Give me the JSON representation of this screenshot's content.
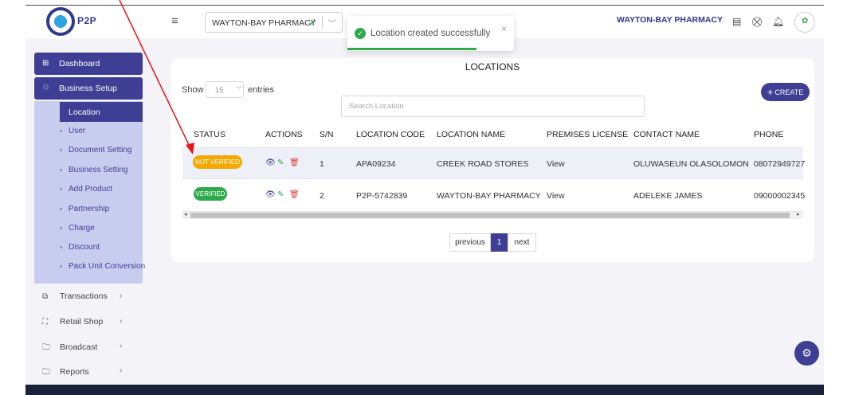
{
  "header": {
    "logo_text": "P2P",
    "branch_value": "WAYTON-BAY PHARMACY",
    "pharmacy_name": "WAYTON-BAY PHARMACY"
  },
  "toast": {
    "message": "Location created successfully",
    "close": "×"
  },
  "sidebar": {
    "dashboard": "Dashboard",
    "business_setup": "Business Setup",
    "sub_items": [
      "Location",
      "User",
      "Document Setting",
      "Business Setting",
      "Add Product",
      "Partnership",
      "Charge",
      "Discount",
      "Pack Unit Conversion"
    ],
    "items": [
      "Transactions",
      "Retail Shop",
      "Broadcast",
      "Reports"
    ]
  },
  "page": {
    "title": "LOCATIONS",
    "show_label": "Show",
    "entries_value": "15",
    "entries_label": "entries",
    "search_placeholder": "Search Location",
    "create_label": "CREATE"
  },
  "table": {
    "headers": [
      "STATUS",
      "ACTIONS",
      "S/N",
      "LOCATION CODE",
      "LOCATION NAME",
      "PREMISES LICENSE",
      "CONTACT NAME",
      "PHONE"
    ],
    "rows": [
      {
        "status": "NOT VERIFIED",
        "sn": "1",
        "code": "APA09234",
        "name": "CREEK ROAD STORES",
        "license": "View",
        "contact": "OLUWASEUN OLASOLOMON",
        "phone": "08072949727"
      },
      {
        "status": "VERIFIED",
        "sn": "2",
        "code": "P2P-5742839",
        "name": "WAYTON-BAY PHARMACY",
        "license": "View",
        "contact": "ADELEKE JAMES",
        "phone": "09000002345"
      }
    ]
  },
  "pagination": {
    "previous": "previous",
    "current": "1",
    "next": "next"
  },
  "colors": {
    "primary": "#3d3e94",
    "success": "#2eaa4a",
    "warning": "#f5a800",
    "submenu_bg": "#c8cdf0",
    "annotation": "#e8141c"
  }
}
